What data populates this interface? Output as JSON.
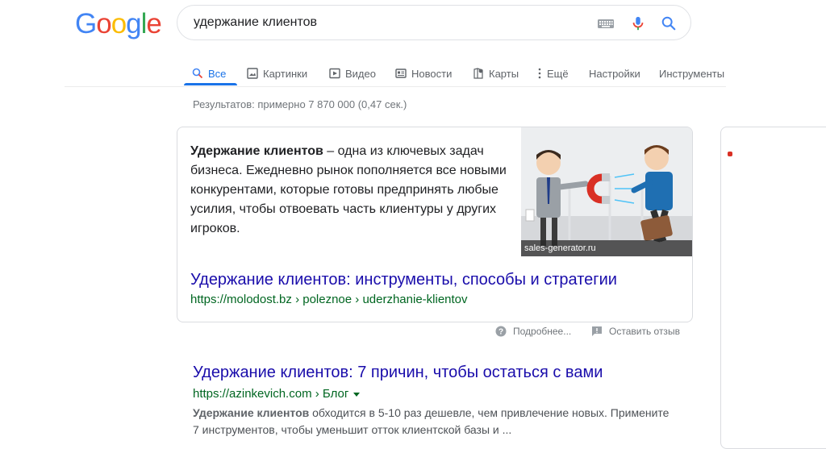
{
  "logo": {
    "letters": [
      "G",
      "o",
      "o",
      "g",
      "l",
      "e"
    ]
  },
  "search": {
    "query": "удержание клиентов"
  },
  "tabs": [
    {
      "label": "Все",
      "icon": "search-icon",
      "active": true
    },
    {
      "label": "Картинки",
      "icon": "image-icon"
    },
    {
      "label": "Видео",
      "icon": "video-icon"
    },
    {
      "label": "Новости",
      "icon": "news-icon"
    },
    {
      "label": "Карты",
      "icon": "map-pin-icon"
    },
    {
      "label": "Ещё",
      "icon": "more-vert-icon"
    },
    {
      "label": "Настройки"
    },
    {
      "label": "Инструменты"
    }
  ],
  "stats": "Результатов: примерно 7 870 000 (0,47 сек.)",
  "featured": {
    "snippet_bold": "Удержание клиентов",
    "snippet_rest": " – одна из ключевых задач бизнеса. Ежедневно рынок пополняется все новыми конкурентами, которые готовы предпринять любые усилия, чтобы отвоевать часть клиентуры у других игроков.",
    "image_caption": "sales-generator.ru",
    "link_title": "Удержание клиентов: инструменты, способы и стратегии",
    "link_url": "https://molodost.bz › poleznoe › uderzhanie-klientov",
    "more_label": "Подробнее...",
    "feedback_label": "Оставить отзыв"
  },
  "result2": {
    "title": "Удержание клиентов: 7 причин, чтобы остаться с вами",
    "url": "https://azinkevich.com › Блог",
    "snippet_bold": "Удержание клиентов",
    "snippet_rest": " обходится в 5-10 раз дешевле, чем привлечение новых. Примените 7 инструментов, чтобы уменьшит отток клиентской базы и ..."
  },
  "colors": {
    "link": "#1a0dab",
    "url": "#006621",
    "accent": "#1a73e8"
  }
}
